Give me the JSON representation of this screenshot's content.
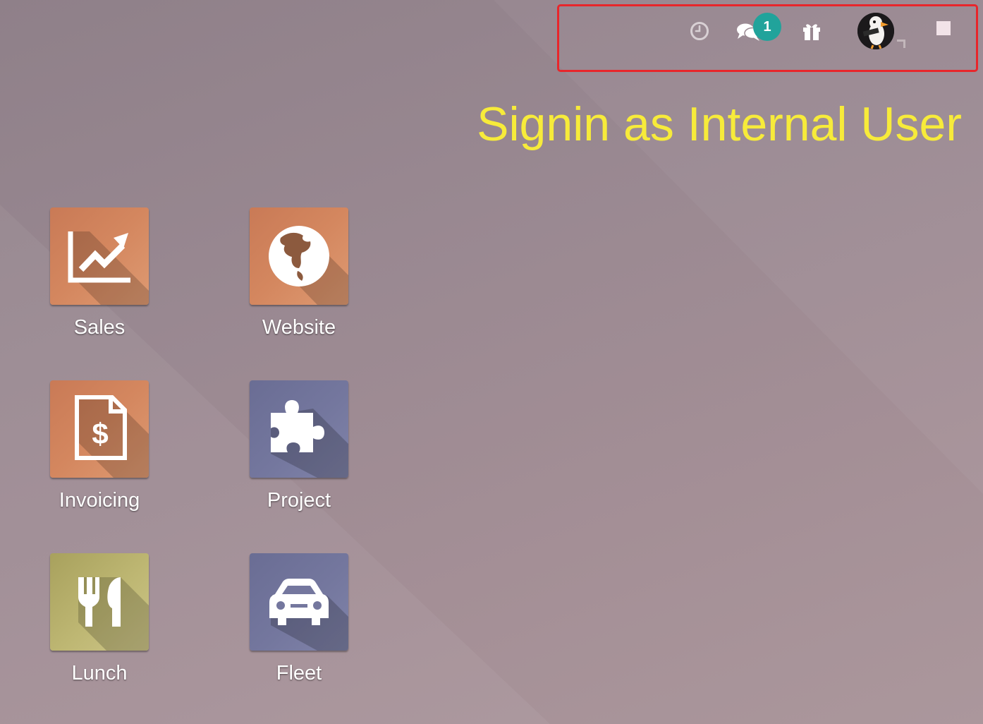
{
  "systray": {
    "activity_icon": "clock-icon",
    "messaging_icon": "comments-icon",
    "messaging_badge": "1",
    "whats_new_icon": "gift-icon",
    "user_avatar": "puffin-avatar",
    "switch_icon": "square-icon"
  },
  "annotation": {
    "text": "Signin as Internal User",
    "color": "#f7eb3a"
  },
  "apps": [
    {
      "label": "Sales",
      "icon": "chart-line-icon",
      "color": "#d4875f"
    },
    {
      "label": "Website",
      "icon": "globe-icon",
      "color": "#d4875f"
    },
    {
      "label": "Invoicing",
      "icon": "invoice-dollar-icon",
      "color": "#d4875f"
    },
    {
      "label": "Project",
      "icon": "puzzle-piece-icon",
      "color": "#74779e"
    },
    {
      "label": "Lunch",
      "icon": "cutlery-icon",
      "color": "#beb773"
    },
    {
      "label": "Fleet",
      "icon": "car-icon",
      "color": "#74779e"
    }
  ],
  "colors": {
    "highlight_border": "#e8262b",
    "badge": "#21a39b"
  }
}
